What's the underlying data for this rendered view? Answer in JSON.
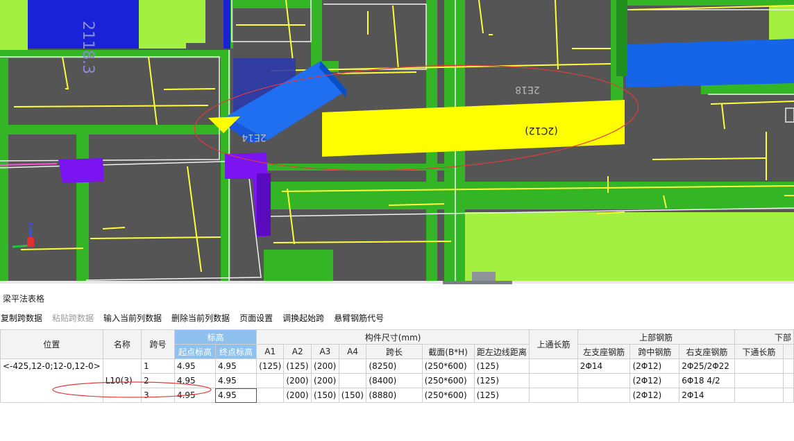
{
  "viewport": {
    "labels": {
      "beam_2c12": "(2C12)",
      "beam_2e18": "2E18",
      "beam_2e14": "2E14",
      "beam_2118": "2118.3"
    },
    "axis": {
      "z": "Z",
      "y": "Y"
    },
    "colors": {
      "background": "#555555",
      "wall": "#33b526",
      "slab": "#a4f041",
      "column_purple": "#7a14f0",
      "beam_blue": "#1664e8",
      "highlight_yellow": "#ffff00",
      "rebar_yellow": "#ffff00",
      "annotation_red": "#e33b3b"
    }
  },
  "panel": {
    "title": "梁平法表格",
    "toolbar": [
      {
        "label": "复制跨数据",
        "enabled": true
      },
      {
        "label": "粘贴跨数据",
        "enabled": false
      },
      {
        "label": "输入当前列数据",
        "enabled": true
      },
      {
        "label": "删除当前列数据",
        "enabled": true
      },
      {
        "label": "页面设置",
        "enabled": true
      },
      {
        "label": "调换起始跨",
        "enabled": true
      },
      {
        "label": "悬臂钢筋代号",
        "enabled": true
      }
    ]
  },
  "table": {
    "group_headers": {
      "elevation": "标高",
      "dimensions": "构件尺寸(mm)",
      "top_rebar": "上部钢筋",
      "bottom_rebar": "下部"
    },
    "columns": {
      "position": "位置",
      "name": "名称",
      "span": "跨号",
      "start_elev": "起点标高",
      "end_elev": "终点标高",
      "a1": "A1",
      "a2": "A2",
      "a3": "A3",
      "a4": "A4",
      "span_length": "跨长",
      "section": "截面(B*H)",
      "edge_distance": "距左边线距离",
      "top_through": "上通长筋",
      "left_support": "左支座钢筋",
      "mid_span": "跨中钢筋",
      "right_support": "右支座钢筋",
      "bottom_through": "下通长筋"
    },
    "position_text": "<-425,12-0;12-0,12-0>",
    "name_text": "L10(3)",
    "rows": [
      {
        "span": "1",
        "start": "4.95",
        "end": "4.95",
        "a1": "(125)",
        "a2": "(125)",
        "a3": "(200)",
        "a4": "",
        "length": "(8250)",
        "section": "(250*600)",
        "edge": "(125)",
        "top_through": "",
        "left": "2Φ14",
        "mid": "(2Φ12)",
        "right": "2Φ25/2Φ22",
        "bottom_through": ""
      },
      {
        "span": "2",
        "start": "4.95",
        "end": "4.95",
        "a1": "",
        "a2": "(200)",
        "a3": "(200)",
        "a4": "",
        "length": "(8400)",
        "section": "(250*600)",
        "edge": "(125)",
        "top_through": "",
        "left": "",
        "mid": "(2Φ12)",
        "right": "6Φ18 4/2",
        "bottom_through": ""
      },
      {
        "span": "3",
        "start": "4.95",
        "end": "4.95",
        "a1": "",
        "a2": "(200)",
        "a3": "(150)",
        "a4": "(150)",
        "length": "(8880)",
        "section": "(250*600)",
        "edge": "(125)",
        "top_through": "",
        "left": "",
        "mid": "(2Φ12)",
        "right": "2Φ14",
        "bottom_through": ""
      }
    ]
  }
}
